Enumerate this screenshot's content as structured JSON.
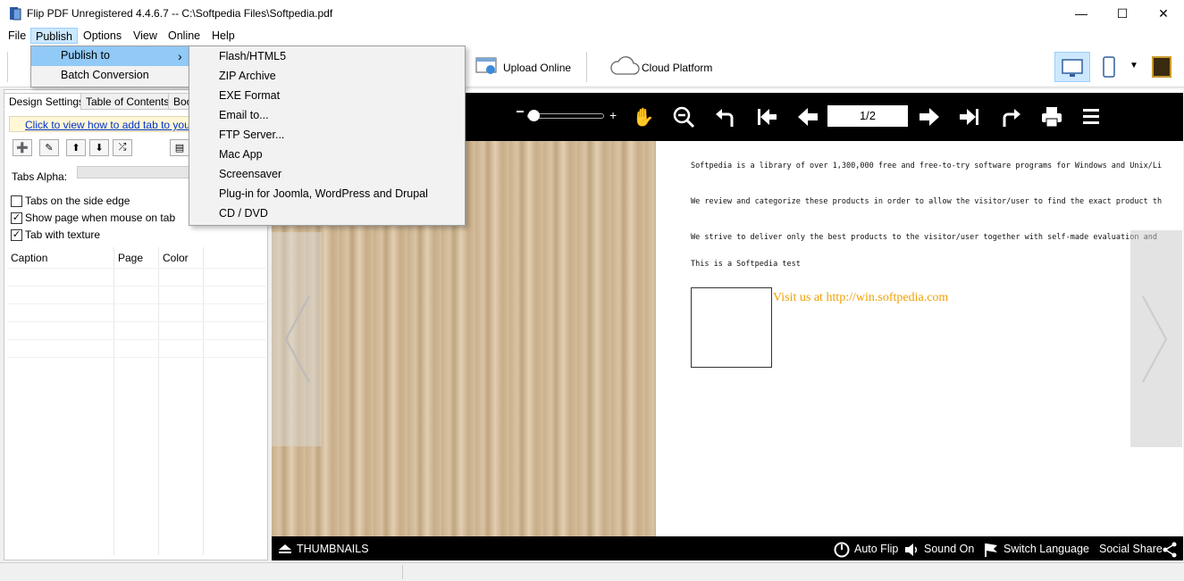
{
  "window": {
    "title": "Flip PDF Unregistered 4.4.6.7 -- C:\\Softpedia Files\\Softpedia.pdf",
    "minimize": "—",
    "maximize": "☐",
    "close": "✕"
  },
  "menubar": {
    "items": [
      {
        "label": "File"
      },
      {
        "label": "Publish"
      },
      {
        "label": "Options"
      },
      {
        "label": "View"
      },
      {
        "label": "Online"
      },
      {
        "label": "Help"
      }
    ]
  },
  "publish_menu": {
    "items": [
      {
        "label": "Publish to",
        "arrow": "›"
      },
      {
        "label": "Batch Conversion"
      }
    ]
  },
  "publish_submenu": {
    "items": [
      {
        "label": "Flash/HTML5"
      },
      {
        "label": "ZIP Archive"
      },
      {
        "label": "EXE Format"
      },
      {
        "label": "Email to..."
      },
      {
        "label": "FTP Server..."
      },
      {
        "label": "Mac App"
      },
      {
        "label": "Screensaver"
      },
      {
        "label": "Plug-in for Joomla, WordPress and Drupal"
      },
      {
        "label": "CD / DVD"
      }
    ]
  },
  "toolbar": {
    "upload_online": "Upload Online",
    "cloud_platform": "Cloud Platform"
  },
  "left_panel": {
    "tabs": [
      {
        "label": "Design Settings"
      },
      {
        "label": "Table of Contents"
      },
      {
        "label": "Boo"
      }
    ],
    "link_text": "Click to view how to add tab to your f",
    "tabs_alpha_label": "Tabs Alpha:",
    "checkboxes": [
      {
        "label": "Tabs on the side edge",
        "checked": false,
        "mark": ""
      },
      {
        "label": "Show page  when  mouse on tab",
        "checked": true,
        "mark": "✓"
      },
      {
        "label": "Tab with texture",
        "checked": true,
        "mark": "✓"
      }
    ],
    "grid_headers": [
      "Caption",
      "Page",
      "Color"
    ]
  },
  "viewer": {
    "page_indicator": "1/2",
    "zoom_plus": "+",
    "page_lines": [
      "Softpedia is a library of over 1,300,000 free and free-to-try software programs for Windows and Unix/Li",
      "We review and categorize these products in order to allow the visitor/user to find the exact product th",
      "We strive to deliver only the best products to the visitor/user together with self-made evaluation and",
      "This is a Softpedia test"
    ],
    "page_link": "Visit us at http://win.softpedia.com",
    "bottom": {
      "thumbnails": "THUMBNAILS",
      "auto_flip": "Auto Flip",
      "sound_on": "Sound On",
      "switch_language": "Switch Language",
      "social_share": "Social Share"
    }
  },
  "colors": {
    "accent": "#cce8ff",
    "menu_highlight": "#91c9f7",
    "link": "#0033cc",
    "pdf_link": "#f0a000"
  }
}
